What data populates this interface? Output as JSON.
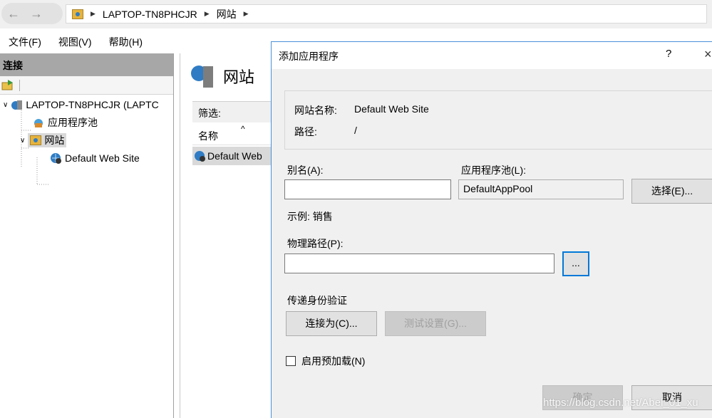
{
  "address": {
    "back_glyph": "←",
    "forward_glyph": "→",
    "crumbs": [
      "LAPTOP-TN8PHCJR",
      "网站"
    ]
  },
  "menu": [
    "文件(F)",
    "视图(V)",
    "帮助(H)"
  ],
  "connections": {
    "title": "连接",
    "tree": {
      "server": "LAPTOP-TN8PHCJR (LAPTC",
      "app_pools": "应用程序池",
      "sites": "网站",
      "default_site": "Default Web Site"
    }
  },
  "middle": {
    "heading": "网站",
    "filter_label": "筛选:",
    "column_name": "名称",
    "row": "Default Web"
  },
  "dialog": {
    "title": "添加应用程序",
    "help": "?",
    "close": "×",
    "site_name_label": "网站名称:",
    "site_name_value": "Default Web Site",
    "path_label": "路径:",
    "path_value": "/",
    "alias_label": "别名(A):",
    "alias_value": "",
    "app_pool_label": "应用程序池(L):",
    "app_pool_value": "DefaultAppPool",
    "select_button": "选择(E)...",
    "example_text": "示例: 销售",
    "physical_path_label": "物理路径(P):",
    "physical_path_value": "",
    "browse_button": "...",
    "pass_through_label": "传递身份验证",
    "connect_as_button": "连接为(C)...",
    "test_settings_button": "测试设置(G)...",
    "preload_label": "启用预加载(N)",
    "preload_checked": false,
    "ok_button": "确定",
    "cancel_button": "取消"
  },
  "watermark": "https://blog.csdn.net/Abel_01_xu"
}
